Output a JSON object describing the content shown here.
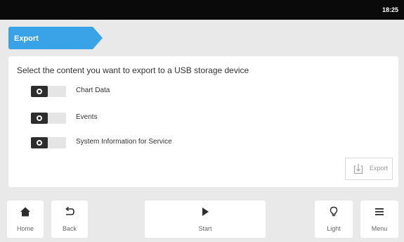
{
  "status": {
    "time": "18:25"
  },
  "breadcrumb": {
    "label": "Export"
  },
  "panel": {
    "prompt": "Select the content you want to export to a USB storage device",
    "options": [
      {
        "label": "Chart Data",
        "state": "off"
      },
      {
        "label": "Events",
        "state": "off"
      },
      {
        "label": "System Information for Service",
        "state": "off"
      }
    ],
    "export_button": {
      "label": "Export",
      "icon": "export-usb-icon",
      "enabled": false
    }
  },
  "bottom_nav": {
    "home": {
      "label": "Home",
      "icon": "home-icon"
    },
    "back": {
      "label": "Back",
      "icon": "back-arrow-icon"
    },
    "start": {
      "label": "Start",
      "icon": "play-icon"
    },
    "light": {
      "label": "Light",
      "icon": "lightbulb-icon"
    },
    "menu": {
      "label": "Menu",
      "icon": "hamburger-menu-icon"
    }
  },
  "colors": {
    "accent": "#3aa3e8",
    "statusbar": "#0a0a0a",
    "toggle_knob": "#2d2d2d",
    "background": "#e9e9e9"
  }
}
